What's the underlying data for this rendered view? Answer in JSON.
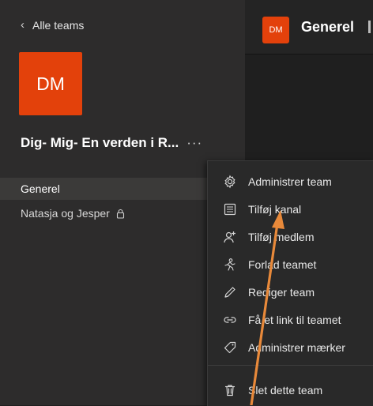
{
  "sidebar": {
    "back_label": "Alle teams",
    "team_initials": "DM",
    "team_name": "Dig- Mig- En verden i R...",
    "more_label": "···",
    "channels": [
      {
        "label": "Generel",
        "active": true
      },
      {
        "label": "Natasja og Jesper",
        "private": true
      }
    ]
  },
  "header": {
    "team_initials": "DM",
    "channel_title": "Generel"
  },
  "context_menu": {
    "items": [
      {
        "label": "Administrer team",
        "icon": "gear-icon"
      },
      {
        "label": "Tilføj kanal",
        "icon": "channel-list-icon"
      },
      {
        "label": "Tilføj medlem",
        "icon": "add-member-icon"
      },
      {
        "label": "Forlad teamet",
        "icon": "leave-icon"
      },
      {
        "label": "Rediger team",
        "icon": "pencil-icon"
      },
      {
        "label": "Få et link til teamet",
        "icon": "link-icon"
      },
      {
        "label": "Administrer mærker",
        "icon": "tag-icon"
      },
      {
        "label": "Slet dette team",
        "icon": "trash-icon"
      }
    ]
  },
  "colors": {
    "accent": "#e3410b",
    "annotation_arrow": "#e8893a"
  }
}
